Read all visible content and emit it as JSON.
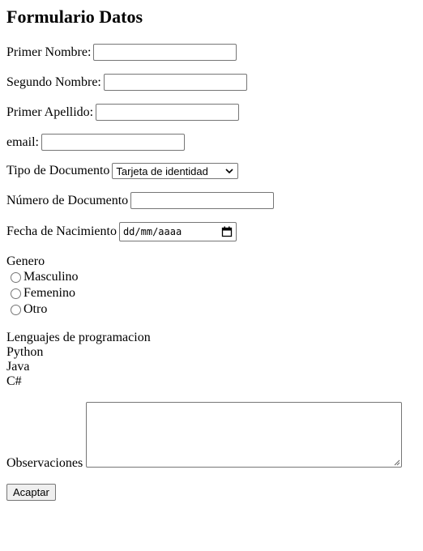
{
  "form": {
    "title": "Formulario Datos",
    "primer_nombre_label": "Primer Nombre:",
    "primer_nombre_value": "",
    "segundo_nombre_label": "Segundo Nombre:",
    "segundo_nombre_value": "",
    "primer_apellido_label": "Primer Apellido:",
    "primer_apellido_value": "",
    "email_label": "email:",
    "email_value": "",
    "tipo_documento_label": "Tipo de Documento",
    "tipo_documento_selected": "Tarjeta de identidad",
    "numero_documento_label": "Número de Documento",
    "numero_documento_value": "",
    "fecha_nacimiento_label": "Fecha de Nacimiento",
    "fecha_nacimiento_placeholder": "dd/mm/aaaa",
    "genero_label": "Genero",
    "genero_options": [
      "Masculino",
      "Femenino",
      "Otro"
    ],
    "lenguajes_label": "Lenguajes de programacion",
    "lenguajes": [
      "Python",
      "Java",
      "C#"
    ],
    "observaciones_label": "Observaciones",
    "observaciones_value": "",
    "submit_label": "Acaptar"
  },
  "icons": {
    "select": "chevron-down-icon",
    "date": "calendar-icon",
    "textarea": "resize-handle-icon"
  }
}
